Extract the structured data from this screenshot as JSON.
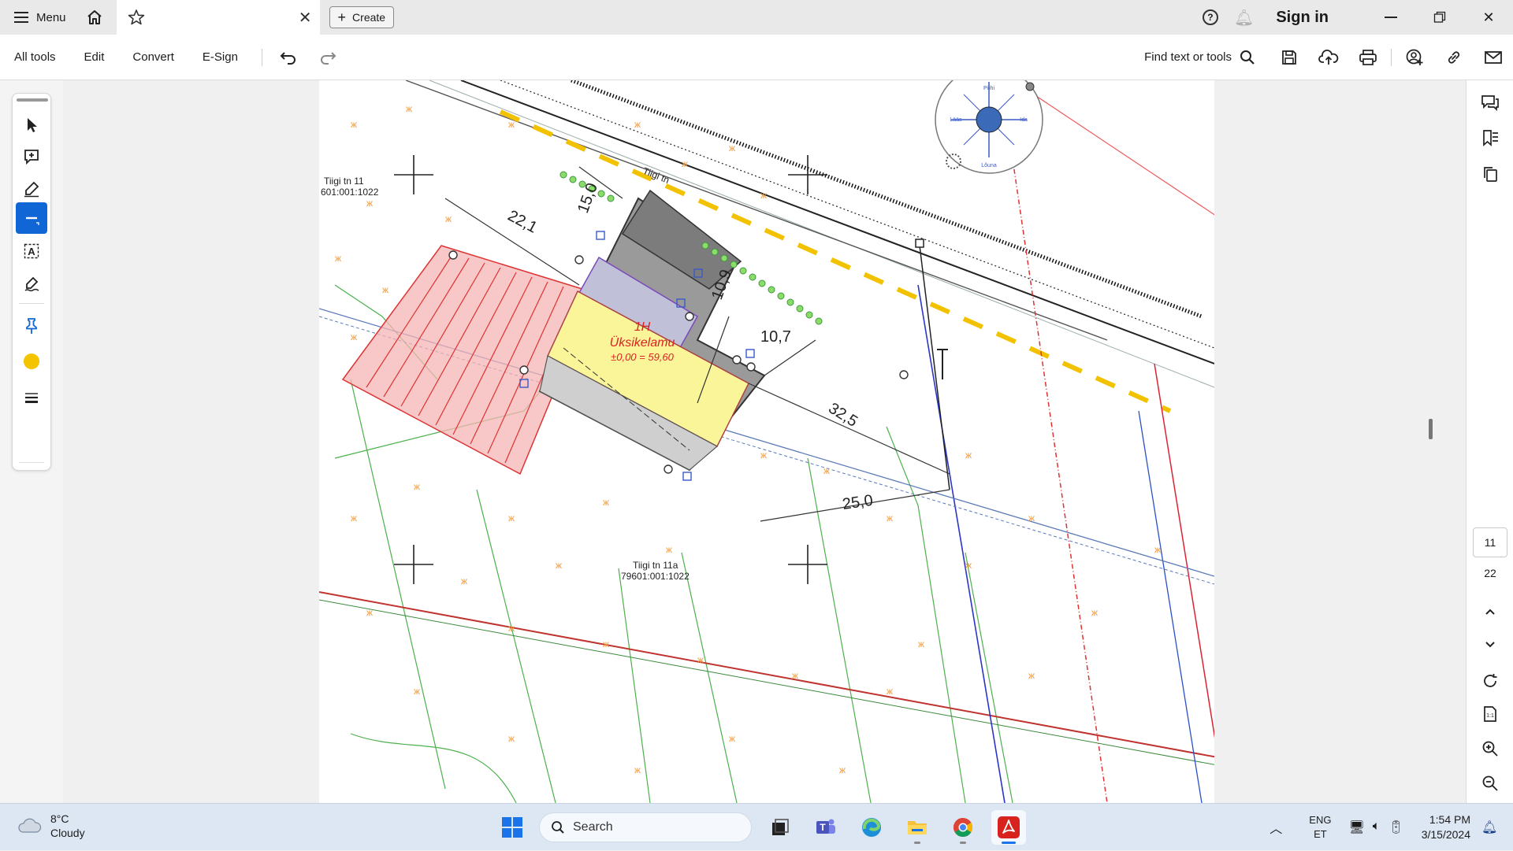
{
  "titlebar": {
    "menu_label": "Menu",
    "create_label": "Create",
    "sign_in_label": "Sign in"
  },
  "toolbar": {
    "items": [
      "All tools",
      "Edit",
      "Convert",
      "E-Sign"
    ],
    "find_label": "Find text or tools"
  },
  "document": {
    "parcel_north_label": "Tiigi tn 11",
    "parcel_north_code": "601:001:1022",
    "parcel_south_label": "Tiigi tn 11a",
    "parcel_south_code": "79601:001:1022",
    "street_label": "Tiigi tn",
    "building_code": "1H",
    "building_type": "Üksikelamu",
    "building_elevation": "±0,00 = 59,60",
    "dimensions": [
      "15,0",
      "22,1",
      "10,9",
      "10,7",
      "32,5",
      "25,0"
    ],
    "compass": {
      "n": "Põhi",
      "e": "Ida",
      "s": "Lõuna",
      "w": "Lääs"
    }
  },
  "navigation": {
    "current_page": "11",
    "total_pages": "22"
  },
  "taskbar": {
    "temperature": "8°C",
    "condition": "Cloudy",
    "search_placeholder": "Search",
    "lang_top": "ENG",
    "lang_bottom": "ET",
    "time": "1:54 PM",
    "date": "3/15/2024"
  },
  "colors": {
    "accent": "#1166d6",
    "acrobat_red": "#d8221d",
    "building_fill": "#fbf59a"
  }
}
